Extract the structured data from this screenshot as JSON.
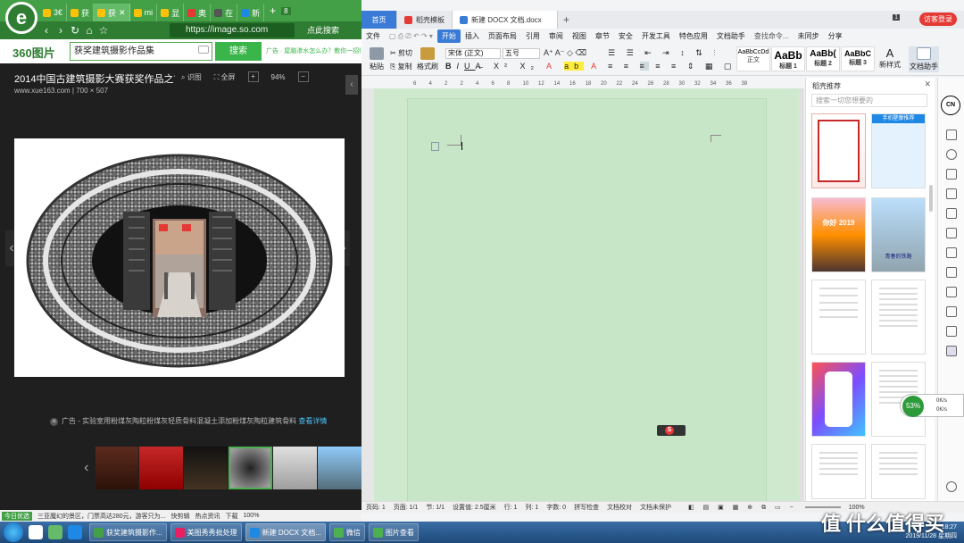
{
  "browser": {
    "tabs": [
      {
        "label": "3€",
        "active": false
      },
      {
        "label": "获",
        "active": false
      },
      {
        "label": "获",
        "active": true
      },
      {
        "label": "mi",
        "active": false
      },
      {
        "label": "显",
        "active": false
      },
      {
        "label": "奥",
        "active": false
      },
      {
        "label": "在",
        "active": false
      },
      {
        "label": "新",
        "active": false
      }
    ],
    "tab_count": "8",
    "url": "https://image.so.com",
    "nav_action": "点此搜索",
    "brand": "360图片",
    "search_query": "获奖建筑摄影作品集",
    "search_button": "搜索",
    "top_ad": "广告 · 屋脑渗水怎么办？教你一招快速",
    "image_title": "2014中国古建筑摄影大赛获奖作品之古建...",
    "image_source": "www.xue163.com",
    "image_size": "700 × 507",
    "tools": {
      "identify": "识图",
      "fullscreen": "全屏",
      "zoom": "94%"
    },
    "bottom_ad": "广告 - 实验室用粉煤灰陶粒粉煤灰轻质骨料混凝土添加粉煤灰陶粒建筑骨料",
    "bottom_ad_link": "查看详情",
    "status_items": [
      "今日优选",
      "三亚魔幻的景区，门票高达280元，游客只为...",
      "快剪辑",
      "热点资讯",
      "下载",
      "100%"
    ]
  },
  "wps": {
    "tabs": [
      "首页",
      "稻壳模板",
      "新建 DOCX 文档.docx"
    ],
    "tab_badge": "1",
    "login": "访客登录",
    "menu": [
      "文件",
      "开始",
      "插入",
      "页面布局",
      "引用",
      "审阅",
      "视图",
      "章节",
      "安全",
      "开发工具",
      "特色应用",
      "文档助手",
      "查找命令...",
      "未同步",
      "分享"
    ],
    "ribbon": {
      "paste": "粘贴",
      "cut": "剪切",
      "copy": "复制",
      "format_painter": "格式刷",
      "font": "宋体 (正文)",
      "size": "五号",
      "styles": [
        {
          "preview": "AaBbCcDd",
          "label": "正文"
        },
        {
          "preview": "AaBb",
          "label": "标题 1"
        },
        {
          "preview": "AaBb(",
          "label": "标题 2"
        },
        {
          "preview": "AaBbC",
          "label": "标题 3"
        }
      ],
      "new_style": "新样式",
      "doc_helper": "文档助手"
    },
    "ruler": [
      "6",
      "4",
      "2",
      "2",
      "4",
      "6",
      "8",
      "10",
      "12",
      "14",
      "16",
      "18",
      "20",
      "22",
      "24",
      "26",
      "28",
      "30",
      "32",
      "34",
      "36",
      "38"
    ],
    "pane": {
      "title": "稻壳推荐",
      "search_placeholder": "搜索一切您想要的",
      "template_texts": [
        "手机壁摩推荐",
        "你好 2019",
        "青春的铁路"
      ]
    },
    "network": {
      "percent": "53%",
      "up": "0K/s",
      "down": "0K/s"
    },
    "status": [
      "页码: 1",
      "页面: 1/1",
      "节: 1/1",
      "设置值: 2.5厘米",
      "行: 1",
      "列: 1",
      "字数: 0",
      "拼写检查",
      "文档校对",
      "文档未保护",
      "100%"
    ]
  },
  "taskbar": {
    "items": [
      "获奖建筑摄影作...",
      "美图秀秀批处理",
      "新建 DOCX 文档...",
      "微信",
      "图片查看"
    ],
    "time": "18:27",
    "date": "2019/11/28 星期四"
  },
  "watermark": "值 什么值得买"
}
